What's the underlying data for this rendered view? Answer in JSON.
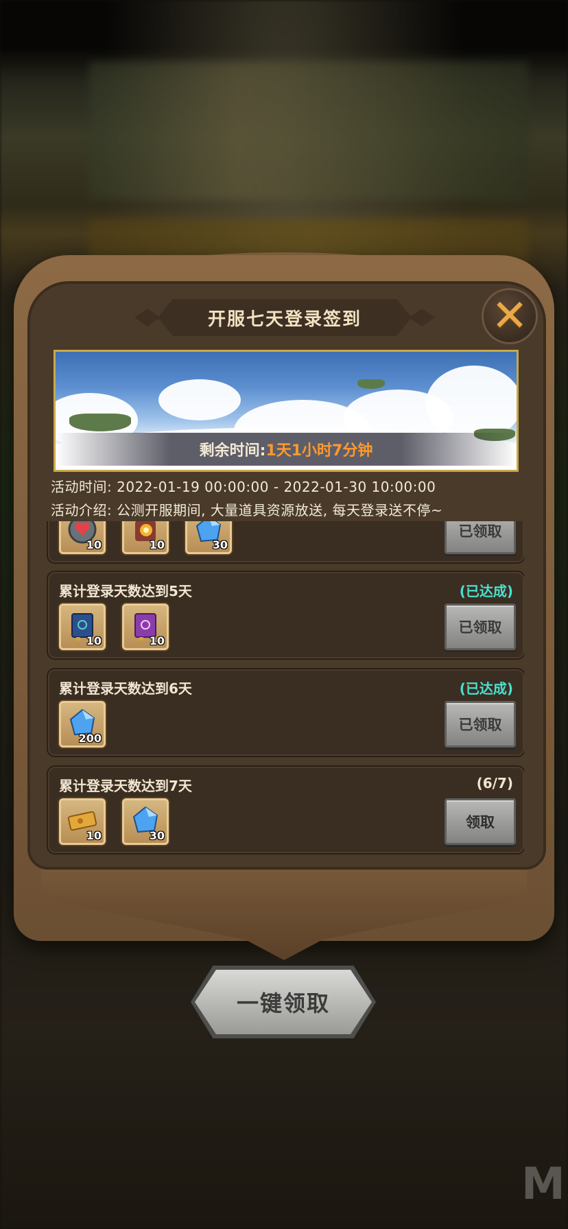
{
  "title": "开服七天登录签到",
  "banner": {
    "remaining_label": "剩余时间:",
    "remaining_value": "1天1小时7分钟"
  },
  "activity": {
    "time_line": "活动时间: 2022-01-19 00:00:00 - 2022-01-30 10:00:00",
    "intro_line": "活动介绍: 公测开服期间, 大量道具资源放送, 每天登录送不停~"
  },
  "rewards": [
    {
      "title": "",
      "status": "",
      "button": "已领取",
      "items": [
        {
          "icon": "heart-potion-icon",
          "qty": "10"
        },
        {
          "icon": "fire-scroll-icon",
          "qty": "10"
        },
        {
          "icon": "blue-crystal-icon",
          "qty": "30"
        }
      ]
    },
    {
      "title": "累计登录天数达到5天",
      "status": "(已达成)",
      "button": "已领取",
      "items": [
        {
          "icon": "blue-book-icon",
          "qty": "10"
        },
        {
          "icon": "purple-book-icon",
          "qty": "10"
        }
      ]
    },
    {
      "title": "累计登录天数达到6天",
      "status": "(已达成)",
      "button": "已领取",
      "items": [
        {
          "icon": "blue-crystal-icon",
          "qty": "200"
        }
      ]
    },
    {
      "title": "累计登录天数达到7天",
      "status": "(6/7)",
      "button": "领取",
      "items": [
        {
          "icon": "gold-ticket-icon",
          "qty": "10"
        },
        {
          "icon": "blue-crystal-icon",
          "qty": "30"
        }
      ]
    }
  ],
  "claim_all_label": "一键领取",
  "colors": {
    "accent_orange": "#ff9a2e",
    "achieved_cyan": "#49e0cf",
    "panel_brown": "#7a5b3b"
  }
}
